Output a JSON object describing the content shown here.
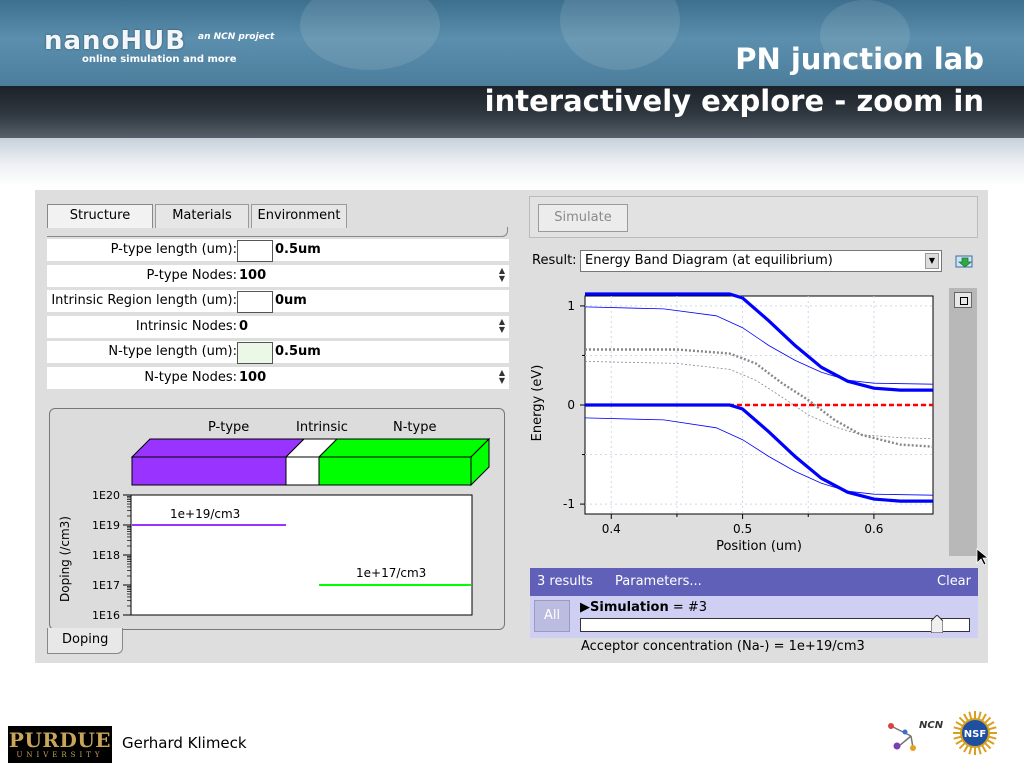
{
  "header": {
    "logo_name": "nanoHUB",
    "logo_tagline": "online simulation and more",
    "logo_badge": "an NCN project",
    "title_line1": "PN junction lab",
    "title_line2": "interactively explore - zoom in"
  },
  "tabs": [
    {
      "label": "Structure",
      "active": true
    },
    {
      "label": "Materials",
      "active": false
    },
    {
      "label": "Environment",
      "active": false
    }
  ],
  "structure_fields": [
    {
      "label": "P-type length (um):",
      "value": "0.5um",
      "swatch": "#ffffff"
    },
    {
      "label": "P-type Nodes:",
      "value": "100"
    },
    {
      "label": "Intrinsic Region length (um):",
      "value": "0um",
      "swatch": "#ffffff"
    },
    {
      "label": "Intrinsic Nodes:",
      "value": "0"
    },
    {
      "label": "N-type length (um):",
      "value": "0.5um",
      "swatch": "#ebf8e8"
    },
    {
      "label": "N-type Nodes:",
      "value": "100"
    }
  ],
  "doping_panel": {
    "region_labels": [
      "P-type",
      "Intrinsic",
      "N-type"
    ],
    "colors": {
      "p_type": "#9933ff",
      "intrinsic": "#ffffff",
      "n_type": "#00ff00"
    },
    "ylabel": "Doping (/cm3)",
    "y_ticks": [
      "1E20",
      "1E19",
      "1E18",
      "1E17",
      "1E16"
    ],
    "p_level_label": "1e+19/cm3",
    "n_level_label": "1e+17/cm3",
    "tab_label": "Doping"
  },
  "simulate_label": "Simulate",
  "result": {
    "label": "Result:",
    "selected": "Energy Band Diagram (at equilibrium)"
  },
  "chart_data": {
    "type": "line",
    "xlabel": "Position (um)",
    "ylabel": "Energy (eV)",
    "xlim": [
      0.38,
      0.645
    ],
    "ylim": [
      -1.1,
      1.1
    ],
    "x_ticks": [
      "0.4",
      "0.5",
      "0.6"
    ],
    "y_ticks": [
      "1",
      "0",
      "-1"
    ],
    "grid": true,
    "colors": {
      "bands": "#0000ff",
      "fermi": "#ff0000",
      "previous": "#888888"
    },
    "series": [
      {
        "x": [
          0.38,
          0.49,
          0.5,
          0.52,
          0.54,
          0.56,
          0.58,
          0.6,
          0.62,
          0.645
        ],
        "values": [
          1.12,
          1.12,
          1.08,
          0.85,
          0.6,
          0.38,
          0.24,
          0.17,
          0.15,
          0.15
        ]
      },
      {
        "x": [
          0.38,
          0.49,
          0.5,
          0.52,
          0.54,
          0.56,
          0.58,
          0.6,
          0.62,
          0.645
        ],
        "values": [
          0.0,
          0.0,
          -0.04,
          -0.27,
          -0.52,
          -0.74,
          -0.88,
          -0.95,
          -0.97,
          -0.97
        ]
      },
      {
        "x": [
          0.38,
          0.645
        ],
        "values": [
          0.0,
          0.0
        ]
      },
      {
        "x": [
          0.38,
          0.44,
          0.48,
          0.5,
          0.52,
          0.54,
          0.56,
          0.58,
          0.6,
          0.645
        ],
        "values": [
          0.99,
          0.97,
          0.9,
          0.78,
          0.6,
          0.45,
          0.33,
          0.25,
          0.22,
          0.21
        ]
      },
      {
        "x": [
          0.38,
          0.44,
          0.48,
          0.5,
          0.52,
          0.54,
          0.56,
          0.58,
          0.6,
          0.645
        ],
        "values": [
          -0.13,
          -0.15,
          -0.23,
          -0.35,
          -0.52,
          -0.67,
          -0.79,
          -0.87,
          -0.9,
          -0.91
        ]
      },
      {
        "x": [
          0.38,
          0.45,
          0.49,
          0.51,
          0.53,
          0.55,
          0.57,
          0.59,
          0.62,
          0.645
        ],
        "values": [
          0.56,
          0.56,
          0.52,
          0.42,
          0.22,
          0.05,
          -0.15,
          -0.3,
          -0.4,
          -0.42
        ]
      },
      {
        "x": [
          0.38,
          0.45,
          0.49,
          0.51,
          0.53,
          0.55,
          0.57,
          0.59,
          0.62,
          0.645
        ],
        "values": [
          0.44,
          0.42,
          0.36,
          0.25,
          0.08,
          -0.1,
          -0.22,
          -0.3,
          -0.33,
          -0.34
        ]
      }
    ]
  },
  "results_bar": {
    "count": "3 results",
    "parameters": "Parameters...",
    "clear": "Clear"
  },
  "simulation": {
    "all_label": "All",
    "title": "Simulation",
    "value": "= #3",
    "slider_fraction": 1.0,
    "acceptor_text": "Acceptor concentration (Na-) = 1e+19/cm3"
  },
  "footer": {
    "university": "PURDUE",
    "university_sub": "UNIVERSITY",
    "author": "Gerhard Klimeck",
    "ncn_logo_text": "NCN",
    "nsf_logo_text": "NSF"
  }
}
